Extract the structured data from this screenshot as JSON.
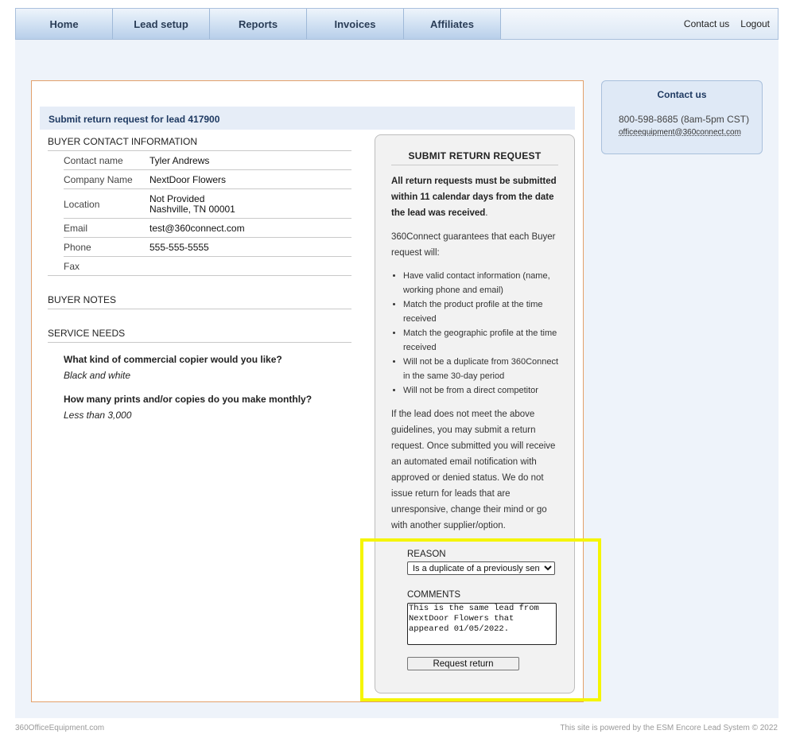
{
  "nav": {
    "items": [
      "Home",
      "Lead setup",
      "Reports",
      "Invoices",
      "Affiliates"
    ],
    "contact_us": "Contact us",
    "logout": "Logout"
  },
  "page": {
    "title": "Submit return request for lead 417900"
  },
  "buyer_contact": {
    "heading": "BUYER CONTACT INFORMATION",
    "rows": [
      {
        "label": "Contact name",
        "value": "Tyler Andrews"
      },
      {
        "label": "Company Name",
        "value": "NextDoor Flowers"
      },
      {
        "label": "Location",
        "value": "Not Provided",
        "value2": "Nashville, TN 00001"
      },
      {
        "label": "Email",
        "value": "test@360connect.com"
      },
      {
        "label": "Phone",
        "value": "555-555-5555"
      },
      {
        "label": "Fax",
        "value": ""
      }
    ]
  },
  "buyer_notes": {
    "heading": "BUYER NOTES"
  },
  "service_needs": {
    "heading": "SERVICE NEEDS",
    "items": [
      {
        "question": "What kind of commercial copier would you like?",
        "answer": "Black and white"
      },
      {
        "question": "How many prints and/or copies do you make monthly?",
        "answer": "Less than 3,000"
      }
    ]
  },
  "return_panel": {
    "title": "SUBMIT RETURN REQUEST",
    "deadline_bold": "All return requests must be submitted within 11 calendar days from the date the lead was received",
    "deadline_tail": ".",
    "guarantee_intro": "360Connect guarantees that each Buyer request will:",
    "guarantees": [
      "Have valid contact information (name, working phone and email)",
      "Match the product profile at the time received",
      "Match the geographic profile at the time received",
      "Will not be a duplicate from 360Connect in the same 30-day period",
      "Will not be from a direct competitor"
    ],
    "policy": "If the lead does not meet the above guidelines, you may submit a return request. Once submitted you will receive an automated email notification with approved or denied status. We do not issue return for leads that are unresponsive, change their mind or go with another supplier/option.",
    "reason_label": "REASON",
    "reason_selected": "Is a duplicate of a previously sent lead",
    "comments_label": "COMMENTS",
    "comments_value": "This is the same lead from NextDoor Flowers that appeared 01/05/2022.",
    "submit_label": "Request return"
  },
  "contact_box": {
    "title": "Contact us",
    "phone": "800-598-8685 (8am-5pm CST)",
    "email": "officeequipment@360connect.com"
  },
  "footer": {
    "left": "360OfficeEquipment.com",
    "right": "This site is powered by the ESM Encore Lead System © 2022"
  },
  "colors": {
    "highlight": "#f5f500",
    "title_text": "#1f3a62",
    "content_border": "#e3a06b"
  }
}
